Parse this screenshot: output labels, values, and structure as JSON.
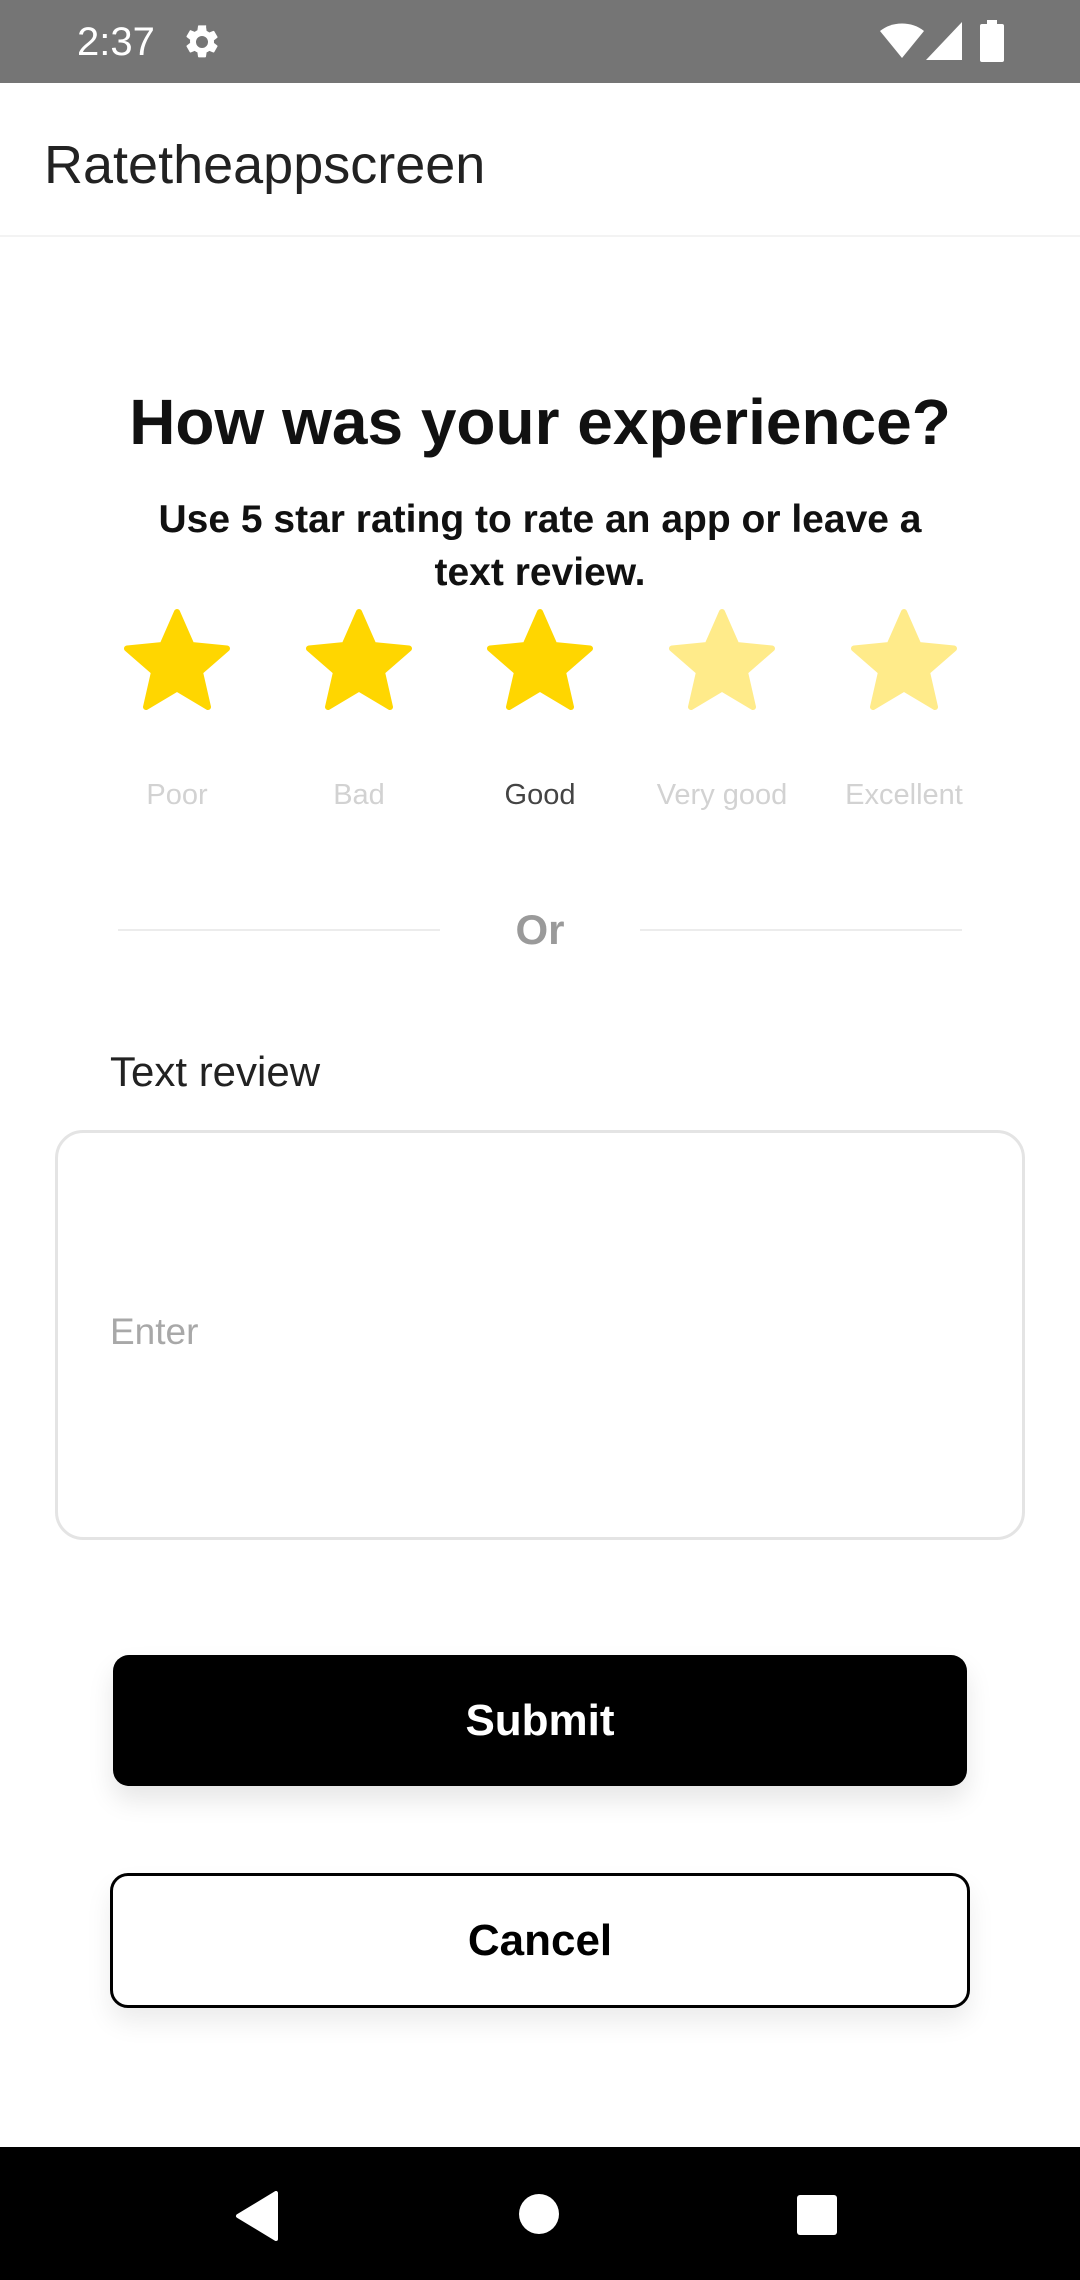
{
  "status_bar": {
    "time": "2:37",
    "icons": [
      "gear-icon",
      "wifi-icon",
      "signal-icon",
      "battery-icon"
    ]
  },
  "app_bar": {
    "title": "Ratetheappscreen"
  },
  "main": {
    "heading": "How was your experience?",
    "subheading": "Use 5 star rating to rate an app or leave a text review.",
    "rating": {
      "selected": 3,
      "max": 5,
      "labels": [
        "Poor",
        "Bad",
        "Good",
        "Very good",
        "Excellent"
      ]
    },
    "divider_text": "Or",
    "review": {
      "label": "Text review",
      "placeholder": "Enter",
      "value": ""
    },
    "submit_label": "Submit",
    "cancel_label": "Cancel"
  },
  "colors": {
    "status_bar": "#757575",
    "star_active": "#FFD600",
    "star_inactive": "#FFEB8A",
    "button_primary": "#000000"
  },
  "nav_bar": {
    "icons": [
      "back-icon",
      "home-icon",
      "recents-icon"
    ]
  }
}
